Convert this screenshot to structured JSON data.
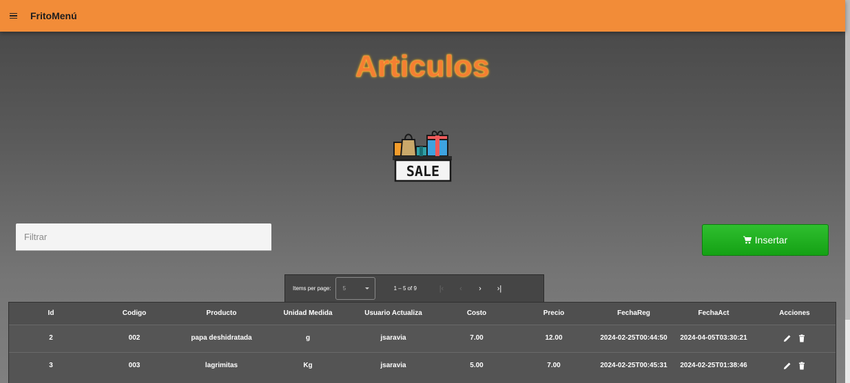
{
  "app": {
    "title": "FritoMenú"
  },
  "page": {
    "title": "Articulos"
  },
  "filter": {
    "placeholder": "Filtrar"
  },
  "insert_button": {
    "label": "Insertar"
  },
  "paginator": {
    "items_per_page_label": "Items per page:",
    "page_size": "5",
    "range_label": "1 – 5 of 9"
  },
  "table": {
    "columns": [
      "Id",
      "Codigo",
      "Producto",
      "Unidad Medida",
      "Usuario Actualiza",
      "Costo",
      "Precio",
      "FechaReg",
      "FechaAct",
      "Acciones"
    ],
    "rows": [
      {
        "id": "2",
        "codigo": "002",
        "producto": "papa deshidratada",
        "unidad": "g",
        "usuario": "jsaravia",
        "costo": "7.00",
        "precio": "12.00",
        "fechareg": "2024-02-25T00:44:50",
        "fechaact": "2024-04-05T03:30:21"
      },
      {
        "id": "3",
        "codigo": "003",
        "producto": "lagrimitas",
        "unidad": "Kg",
        "usuario": "jsaravia",
        "costo": "5.00",
        "precio": "7.00",
        "fechareg": "2024-02-25T00:45:31",
        "fechaact": "2024-02-25T01:38:46"
      }
    ]
  },
  "icons": {
    "menu": "menu-icon",
    "cart": "cart-icon",
    "edit": "pencil-icon",
    "delete": "trash-icon"
  },
  "colors": {
    "topbar": "#f28c38",
    "title": "#f57f32",
    "insert_button": "#1fae1f"
  }
}
